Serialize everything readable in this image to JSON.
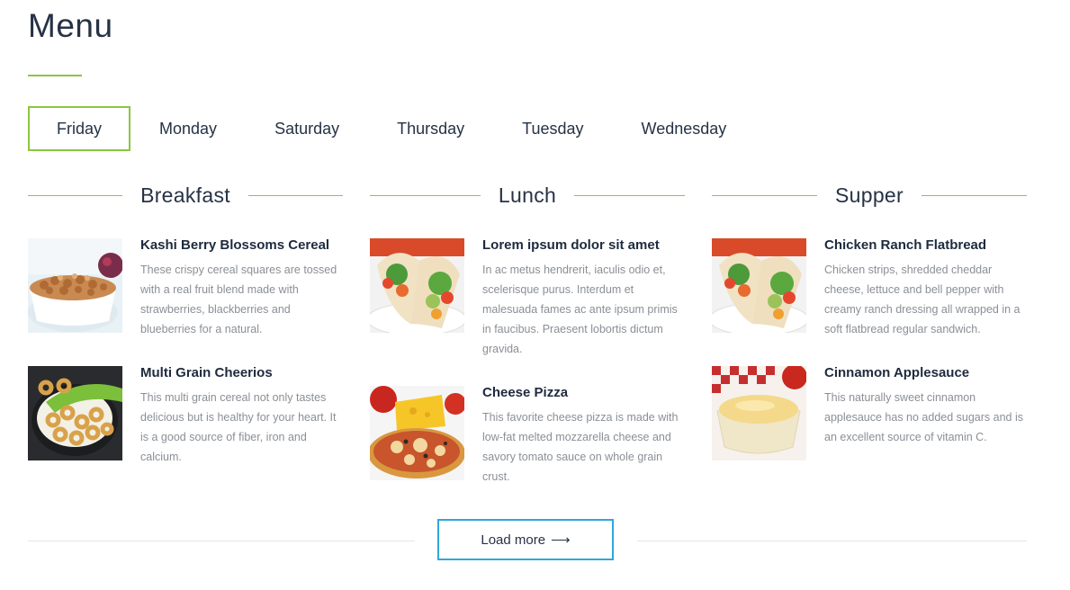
{
  "page": {
    "title": "Menu"
  },
  "tabs": [
    {
      "label": "Friday",
      "active": true
    },
    {
      "label": "Monday",
      "active": false
    },
    {
      "label": "Saturday",
      "active": false
    },
    {
      "label": "Thursday",
      "active": false
    },
    {
      "label": "Tuesday",
      "active": false
    },
    {
      "label": "Wednesday",
      "active": false
    }
  ],
  "meals": {
    "breakfast": {
      "title": "Breakfast",
      "items": [
        {
          "name": "Kashi Berry Blossoms Cereal",
          "description": "These crispy cereal squares are tossed with a real fruit blend made with strawberries, blackberries and blueberries for a natural.",
          "image": "cereal-bowl-photo"
        },
        {
          "name": "Multi Grain Cheerios",
          "description": "This multi grain cereal not only tastes delicious but is healthy for your heart. It is a good source of fiber, iron and calcium.",
          "image": "cheerios-photo"
        }
      ]
    },
    "lunch": {
      "title": "Lunch",
      "items": [
        {
          "name": "Lorem ipsum dolor sit amet",
          "description": "In ac metus hendrerit, iaculis odio et, scelerisque purus. Interdum et malesuada fames ac ante ipsum primis in faucibus. Praesent lobortis dictum gravida.",
          "image": "wrap-photo"
        },
        {
          "name": "Cheese Pizza",
          "description": "This favorite cheese pizza is made with low-fat melted mozzarella cheese and savory tomato sauce on whole grain crust.",
          "image": "pizza-photo"
        }
      ]
    },
    "supper": {
      "title": "Supper",
      "items": [
        {
          "name": "Chicken Ranch Flatbread",
          "description": "Chicken strips, shredded cheddar cheese, lettuce and bell pepper with creamy ranch dressing all wrapped in a soft flatbread regular sandwich.",
          "image": "flatbread-photo"
        },
        {
          "name": "Cinnamon Applesauce",
          "description": "This naturally sweet cinnamon applesauce has no added sugars and is an excellent source of vitamin C.",
          "image": "applesauce-photo"
        }
      ]
    }
  },
  "footer": {
    "load_more_label": "Load more",
    "load_more_icon": "arrow-right-icon",
    "arrow_glyph": "⟶"
  },
  "colors": {
    "accent_green": "#8cc63f",
    "button_border_blue": "#2ea8dc",
    "heading_text": "#263245",
    "muted_text": "#8a8f96"
  }
}
